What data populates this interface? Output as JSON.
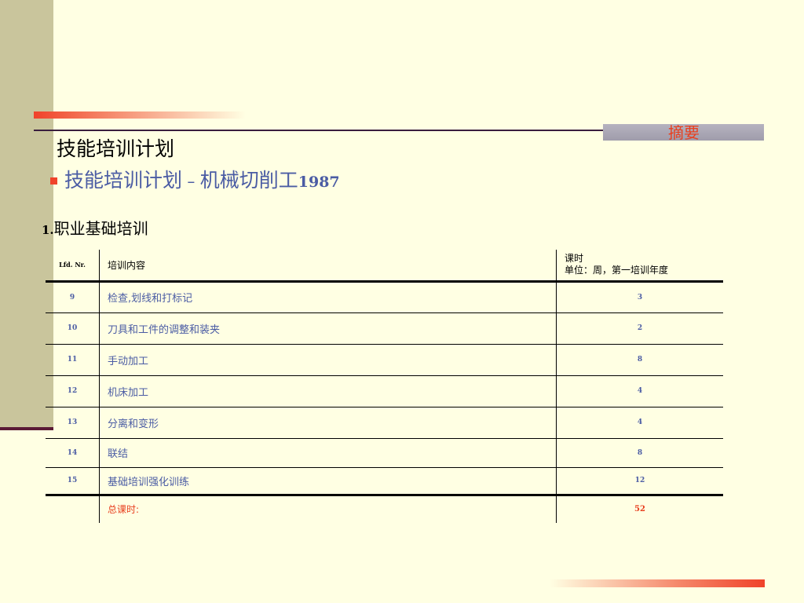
{
  "header": {
    "summary_label": "摘要",
    "page_title": "技能培训计划"
  },
  "subtitle": {
    "text": "技能培训计划",
    "dash": " – ",
    "trade": "机械切削工",
    "year": "1987"
  },
  "section": {
    "number": "1.",
    "title": "职业基础培训"
  },
  "table": {
    "headers": {
      "nr": "Lfd. Nr.",
      "content": "培训内容",
      "hours_line1": "课时",
      "hours_line2": "单位：周，第一培训年度"
    },
    "rows": [
      {
        "nr": "9",
        "content": "检查,划线和打标记",
        "hours": "3"
      },
      {
        "nr": "10",
        "content": "刀具和工件的调整和装夹",
        "hours": "2"
      },
      {
        "nr": "11",
        "content": "手动加工",
        "hours": "8"
      },
      {
        "nr": "12",
        "content": "机床加工",
        "hours": "4"
      },
      {
        "nr": "13",
        "content": "分离和变形",
        "hours": "4"
      },
      {
        "nr": "14",
        "content": "联结",
        "hours": "8"
      },
      {
        "nr": "15",
        "content": "基础培训强化训练",
        "hours": "12"
      }
    ],
    "total": {
      "label": "总课时:",
      "hours": "52"
    }
  },
  "colors": {
    "background": "#FFFFE3",
    "accent_red": "#F0432A",
    "text_blue": "#4B5CA4",
    "side_bar": "#C9C59C"
  }
}
